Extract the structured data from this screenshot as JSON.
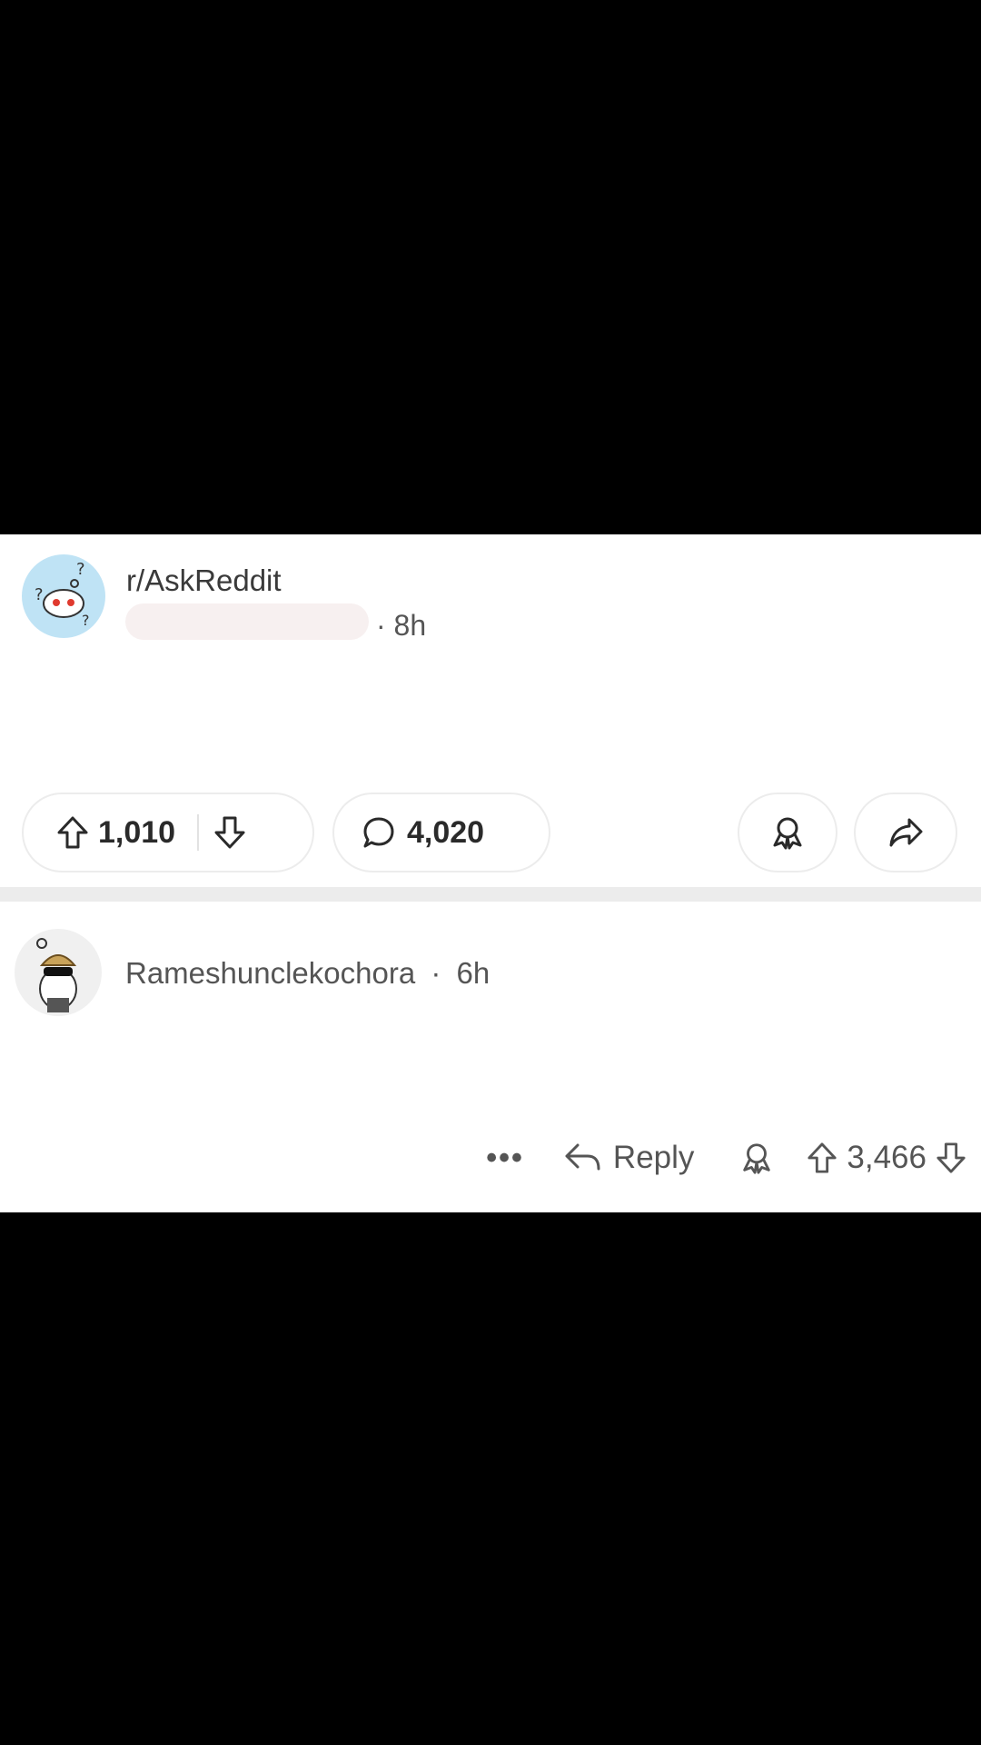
{
  "post": {
    "subreddit": "r/AskReddit",
    "separator": "·",
    "time": "8h",
    "upvotes": "1,010",
    "comments": "4,020"
  },
  "comment": {
    "username": "Rameshunclekochora",
    "separator": "·",
    "time": "6h",
    "more_label": "•••",
    "reply_label": "Reply",
    "score": "3,466"
  },
  "colors": {
    "background": "#000000",
    "card": "#ffffff",
    "divider": "#ececec",
    "text": "#555555"
  },
  "icons": [
    "subreddit-avatar",
    "upvote-icon",
    "downvote-icon",
    "comment-bubble-icon",
    "award-icon",
    "share-icon",
    "reply-arrow-icon",
    "user-avatar"
  ]
}
